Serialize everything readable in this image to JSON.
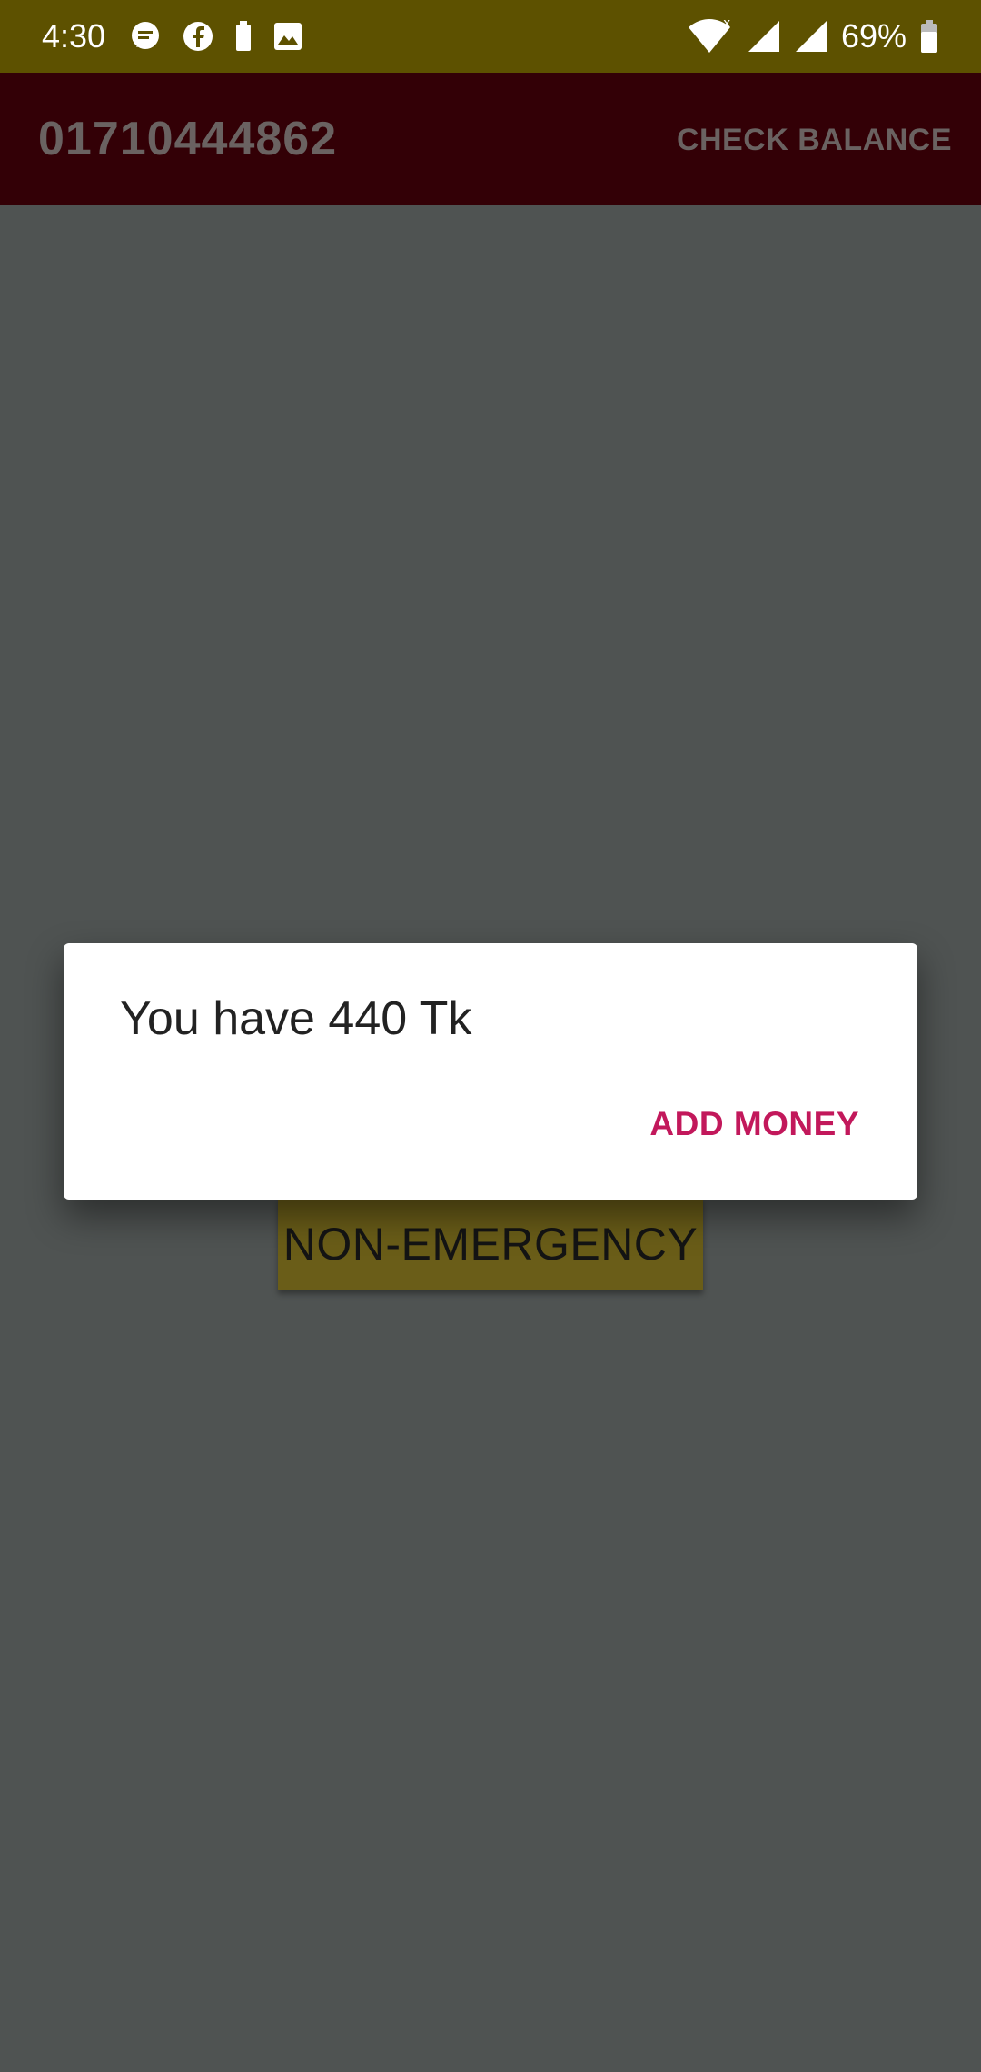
{
  "status_bar": {
    "time": "4:30",
    "notification_icons": [
      "chat-bubble-icon",
      "facebook-icon",
      "battery-saver-icon",
      "image-icon"
    ],
    "system_icons": [
      "wifi-icon",
      "cell-signal-icon",
      "cell-signal-icon",
      "battery-icon"
    ],
    "battery_percent": "69%"
  },
  "app_bar": {
    "title": "01710444862",
    "action_label": "CHECK BALANCE",
    "background_color": "#330006"
  },
  "content": {
    "button_label": "NON-EMERGENCY"
  },
  "dialog": {
    "message": "You have 440 Tk",
    "action_label": "ADD MONEY",
    "action_color": "#c2185b"
  }
}
